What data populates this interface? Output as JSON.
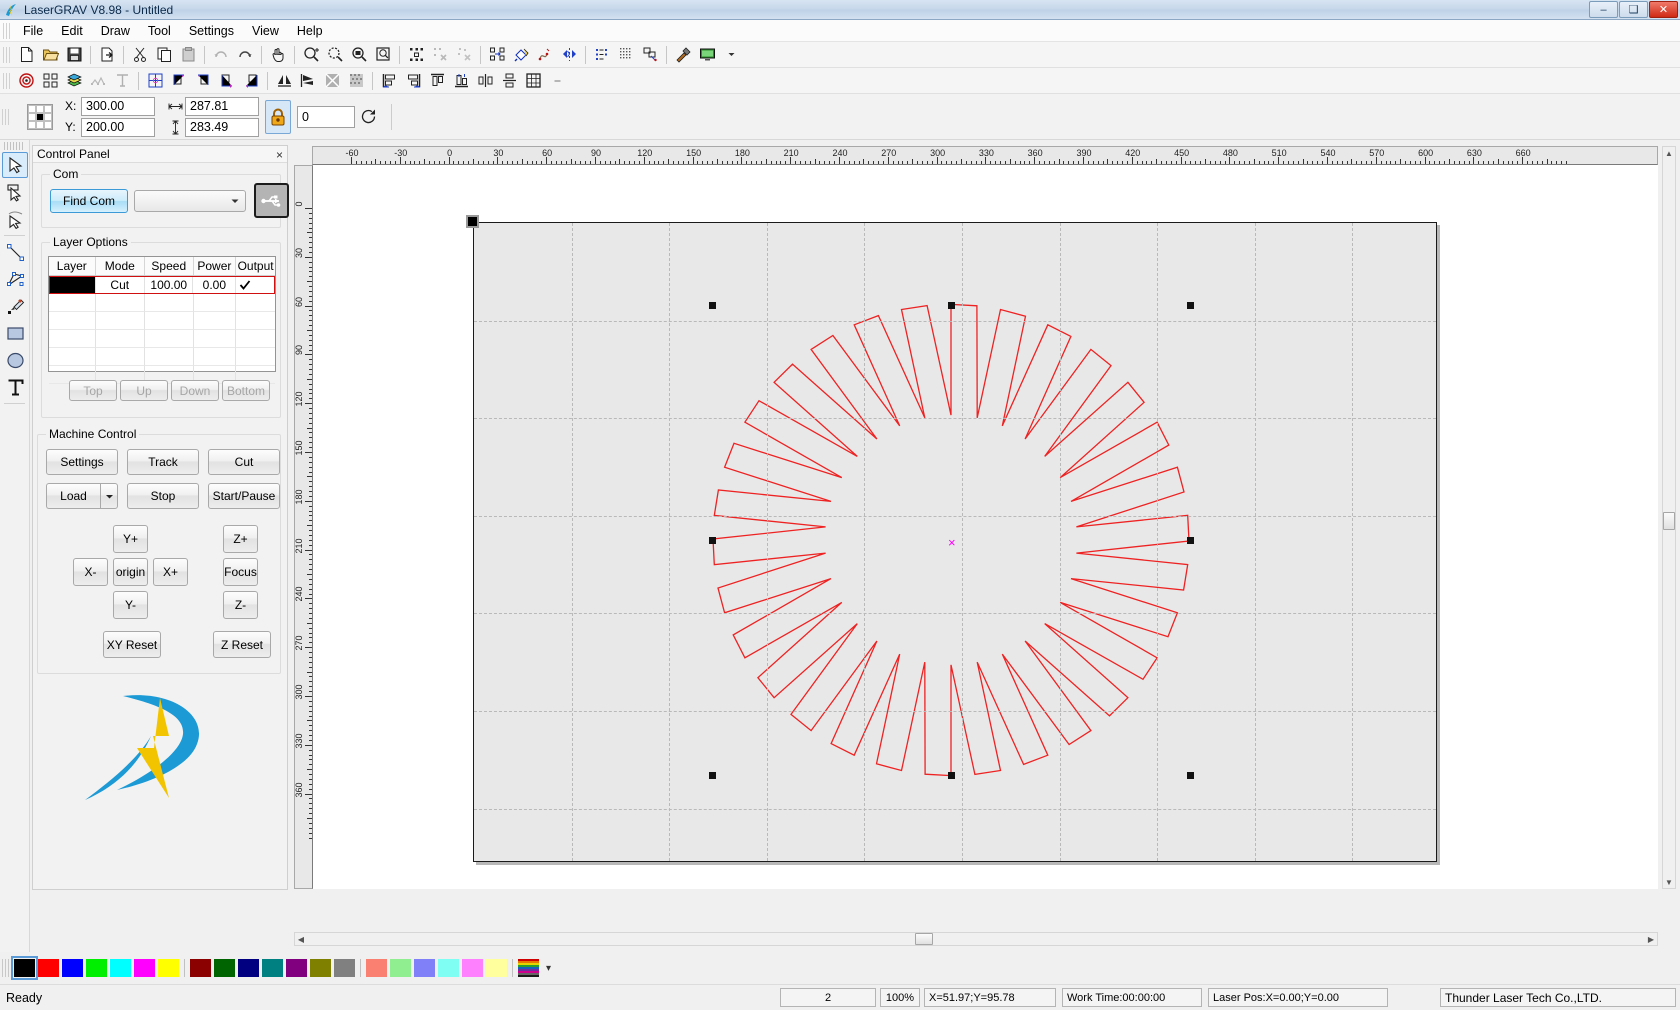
{
  "window": {
    "title": "LaserGRAV V8.98 - Untitled",
    "app_icon": "lasergrav-logo-icon",
    "minimize_label": "–",
    "maximize_label": "❑",
    "close_label": "✕"
  },
  "menubar": {
    "items": [
      {
        "label": "File",
        "accel": "F"
      },
      {
        "label": "Edit",
        "accel": "E"
      },
      {
        "label": "Draw",
        "accel": "D"
      },
      {
        "label": "Tool",
        "accel": "T"
      },
      {
        "label": "Settings",
        "accel": "S"
      },
      {
        "label": "View",
        "accel": "V"
      },
      {
        "label": "Help",
        "accel": "H"
      }
    ]
  },
  "toolbar_row1": [
    {
      "name": "new-file-icon"
    },
    {
      "name": "open-file-icon"
    },
    {
      "name": "save-file-icon"
    },
    {
      "sep": true
    },
    {
      "name": "export-icon"
    },
    {
      "sep": true
    },
    {
      "name": "cut-icon"
    },
    {
      "name": "copy-icon"
    },
    {
      "name": "paste-icon"
    },
    {
      "sep": true
    },
    {
      "name": "undo-icon"
    },
    {
      "name": "redo-icon"
    },
    {
      "sep": true
    },
    {
      "name": "pan-hand-icon"
    },
    {
      "sep": true
    },
    {
      "name": "zoom-inout-icon"
    },
    {
      "name": "zoom-selection-icon"
    },
    {
      "name": "zoom-page-icon"
    },
    {
      "name": "zoom-fit-icon"
    },
    {
      "sep": true
    },
    {
      "name": "node-edit-icon"
    },
    {
      "name": "delete-node-icon"
    },
    {
      "name": "break-node-icon"
    },
    {
      "sep": true
    },
    {
      "name": "group-icon"
    },
    {
      "name": "fill-icon"
    },
    {
      "name": "curve-smooth-icon"
    },
    {
      "name": "mirror-merge-icon"
    },
    {
      "sep": true
    },
    {
      "name": "list-view-icon"
    },
    {
      "name": "dot-matrix-icon"
    },
    {
      "name": "offset-icon"
    },
    {
      "sep": true
    },
    {
      "name": "hammer-tool-icon"
    },
    {
      "name": "monitor-preview-icon"
    },
    {
      "name": "more-chevron-icon"
    }
  ],
  "toolbar_row2": [
    {
      "name": "target-origin-icon"
    },
    {
      "name": "array-copy-icon"
    },
    {
      "name": "layers-icon"
    },
    {
      "name": "sort-path-icon"
    },
    {
      "name": "text-tool-icon"
    },
    {
      "sep": true
    },
    {
      "name": "grid-snap-icon"
    },
    {
      "name": "align-top-left-icon"
    },
    {
      "name": "align-top-right-icon"
    },
    {
      "name": "align-bottom-left-icon"
    },
    {
      "name": "align-bottom-right-icon"
    },
    {
      "sep": true
    },
    {
      "name": "mirror-horizontal-icon"
    },
    {
      "name": "mirror-vertical-icon"
    },
    {
      "name": "invert-icon"
    },
    {
      "name": "dither-icon"
    },
    {
      "sep": true
    },
    {
      "name": "align-left-icon"
    },
    {
      "name": "align-right-icon"
    },
    {
      "name": "align-vtop-icon"
    },
    {
      "name": "align-vbottom-icon"
    },
    {
      "name": "align-center-h-icon"
    },
    {
      "name": "align-center-v-icon"
    },
    {
      "name": "align-grid-icon"
    },
    {
      "name": "more-chevron-icon"
    }
  ],
  "position_bar": {
    "anchor_name": "anchor-point-selector",
    "x_label": "X:",
    "x_value": "300.00",
    "y_label": "Y:",
    "y_value": "200.00",
    "width_icon": "width-arrow-icon",
    "width_value": "287.81",
    "height_icon": "height-arrow-icon",
    "height_value": "283.49",
    "lock_icon": "lock-aspect-icon",
    "lock_on": true,
    "rotation_value": "0",
    "rotate_icon": "rotate-icon"
  },
  "left_tools": [
    {
      "name": "select-arrow-tool",
      "selected": true
    },
    {
      "name": "select-rect-tool",
      "selected": false
    },
    {
      "name": "node-edit-tool",
      "selected": false
    },
    {
      "sep": true
    },
    {
      "name": "line-tool",
      "selected": false
    },
    {
      "name": "polyline-tool",
      "selected": false
    },
    {
      "name": "pen-draw-tool",
      "selected": false
    },
    {
      "name": "rectangle-tool",
      "selected": false
    },
    {
      "name": "ellipse-tool",
      "selected": false
    },
    {
      "name": "text-tool",
      "selected": false
    }
  ],
  "control_panel": {
    "title": "Control Panel",
    "close_label": "×",
    "com": {
      "group_label": "Com",
      "find_com_label": "Find Com",
      "port_value": "",
      "port_placeholder": "",
      "usb_icon": "usb-connect-icon"
    },
    "layer_options": {
      "group_label": "Layer Options",
      "columns": [
        "Layer",
        "Mode",
        "Speed",
        "Power",
        "Output"
      ],
      "rows": [
        {
          "color": "#000000",
          "mode": "Cut",
          "speed": "100.00",
          "power": "0.00",
          "output": true,
          "selected": true
        }
      ],
      "empty_row_count": 5,
      "order_buttons": [
        "Top",
        "Up",
        "Down",
        "Bottom"
      ]
    },
    "machine_control": {
      "group_label": "Machine Control",
      "settings_label": "Settings",
      "track_label": "Track",
      "cut_label": "Cut",
      "load_label": "Load",
      "load_dropdown_icon": "chevron-down-icon",
      "stop_label": "Stop",
      "start_pause_label": "Start/Pause",
      "y_plus_label": "Y+",
      "x_minus_label": "X-",
      "origin_label": "origin",
      "x_plus_label": "X+",
      "y_minus_label": "Y-",
      "z_plus_label": "Z+",
      "focus_label": "Focus",
      "z_minus_label": "Z-",
      "xy_reset_label": "XY Reset",
      "z_reset_label": "Z Reset"
    },
    "logo_name": "thunder-laser-logo"
  },
  "canvas": {
    "h_ruler_labels": [
      "-60",
      "-30",
      "0",
      "30",
      "60",
      "90",
      "120",
      "150",
      "180",
      "210",
      "240",
      "270",
      "300",
      "330",
      "360",
      "390",
      "420",
      "450",
      "480",
      "510",
      "540",
      "570",
      "600",
      "630",
      "660"
    ],
    "v_ruler_labels": [
      "0",
      "30",
      "60",
      "90",
      "120",
      "150",
      "180",
      "210",
      "240",
      "270",
      "300",
      "330",
      "360"
    ],
    "worksheet_name": "work-area",
    "origin_marker_name": "origin-marker",
    "center_marker": "×",
    "selection_handles": 8,
    "shape_name": "starburst-vector-shape",
    "shape_color": "#ee2222",
    "shape_points": 30,
    "shape_outer_radius": 0.98,
    "shape_inner_radius": 0.53,
    "shape_skew": 0.52,
    "vscrollbar_name": "vertical-scrollbar",
    "hscrollbar_name": "horizontal-scrollbar"
  },
  "palette": {
    "colors": [
      "#000000",
      "#ff0000",
      "#0000ff",
      "#00ee00",
      "#00ffff",
      "#ff00ff",
      "#ffff00",
      "#8b0000",
      "#006400",
      "#000080",
      "#008080",
      "#800080",
      "#808000",
      "#808080",
      "#fa8072",
      "#90ee90",
      "#8080f8",
      "#7ffff4",
      "#ff80ff",
      "#ffff9e"
    ],
    "selected_index": 0,
    "separator_after": [
      6,
      13
    ],
    "rainbow_name": "gradient-palette-swatch",
    "more_chevron": "▾"
  },
  "statusbar": {
    "ready_text": "Ready",
    "object_count": "2",
    "zoom_level": "100%",
    "cursor_pos": "X=51.97;Y=95.78",
    "work_time": "Work Time:00:00:00",
    "laser_pos": "Laser Pos:X=0.00;Y=0.00",
    "vendor": "Thunder Laser Tech Co.,LTD."
  }
}
